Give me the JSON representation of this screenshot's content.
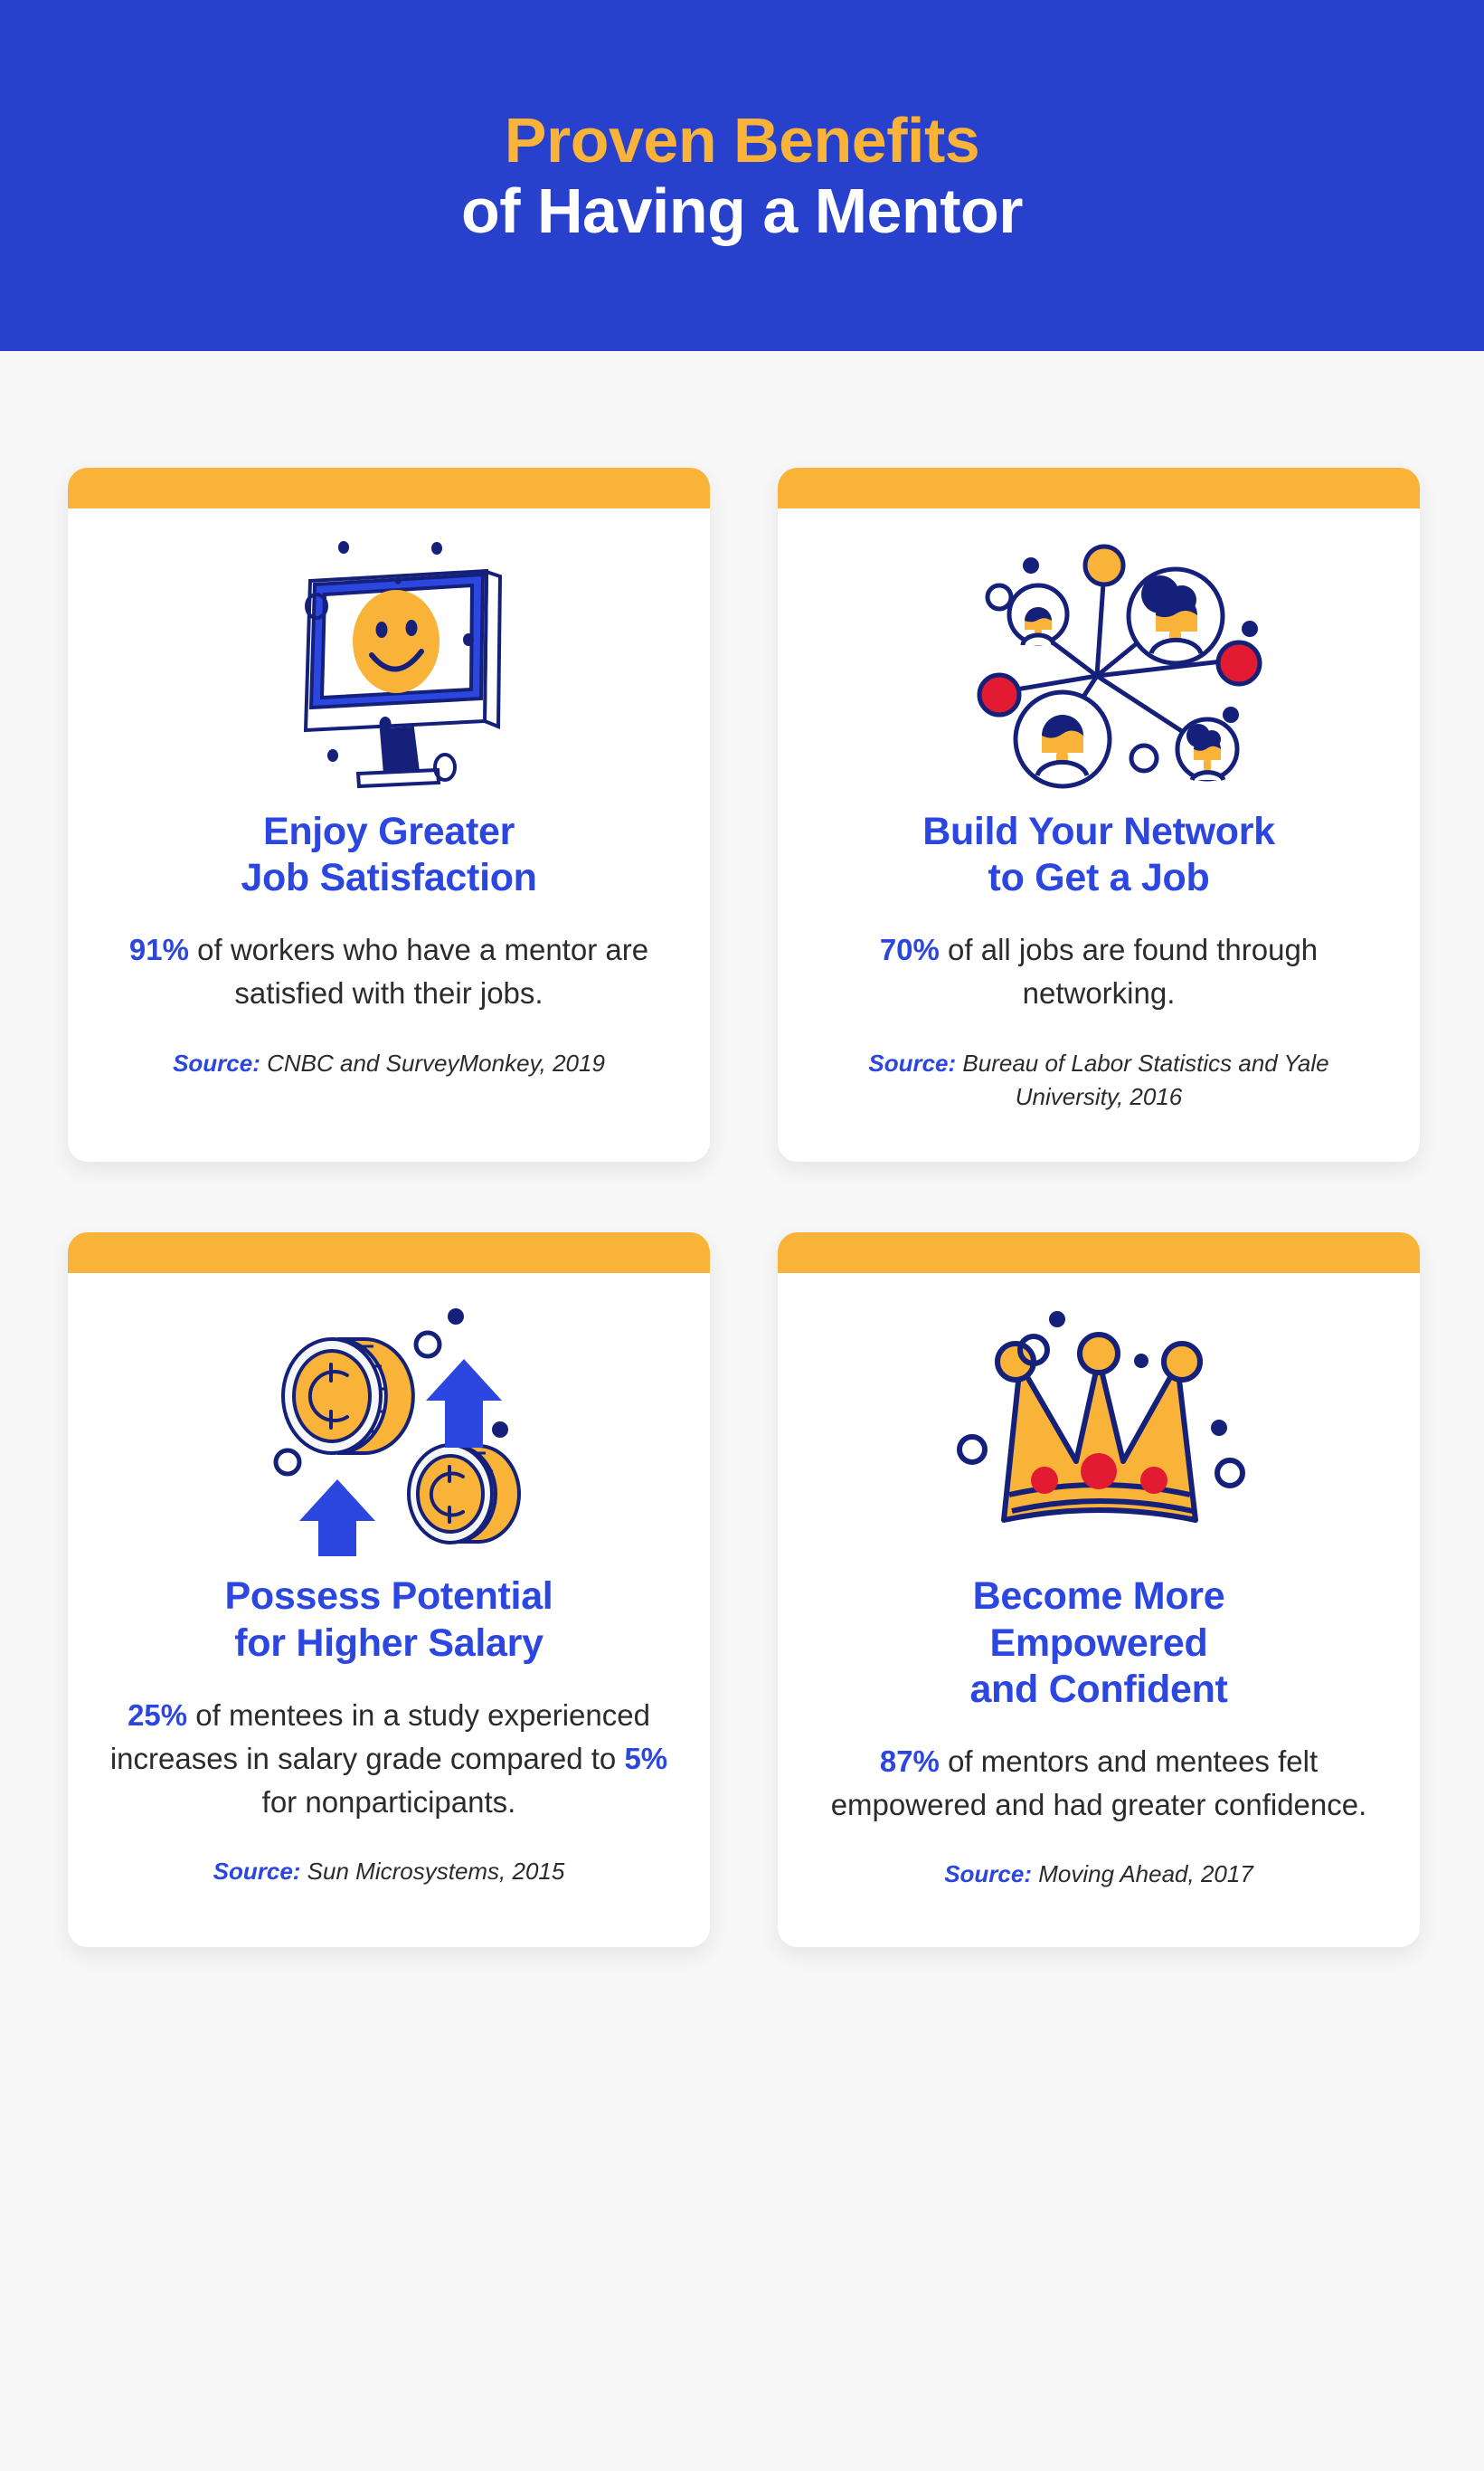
{
  "header": {
    "title_line1": "Proven Benefits",
    "title_line2": "of Having a Mentor",
    "bg_color": "#2741CC",
    "accent_color": "#F9B338"
  },
  "theme": {
    "page_bg": "#F7F7F8",
    "card_bg": "#FFFFFF",
    "card_topbar": "#F9B338",
    "title_blue": "#2C46E0",
    "line_navy": "#14207A",
    "yellow": "#F9B338",
    "red": "#E31B32",
    "body_text": "#2B2B2B"
  },
  "cards": [
    {
      "icon": "smiley-monitor-icon",
      "title_line1": "Enjoy Greater",
      "title_line2": "Job Satisfaction",
      "stat_value": "91%",
      "stat_text": " of workers who have a mentor are satisfied with their jobs.",
      "source_label": "Source:",
      "source_text": " CNBC and SurveyMonkey, 2019"
    },
    {
      "icon": "people-network-icon",
      "title_line1": "Build Your Network",
      "title_line2": "to Get a Job",
      "stat_value": "70%",
      "stat_text": " of all jobs are found through networking.",
      "source_label": "Source:",
      "source_text": " Bureau of Labor Statistics and Yale University, 2016"
    },
    {
      "icon": "coins-up-arrows-icon",
      "title_line1": "Possess Potential",
      "title_line2": "for Higher Salary",
      "stat_value": "25%",
      "stat_text_a": " of mentees in a study experienced increases in salary grade compared to ",
      "stat_value_2": "5%",
      "stat_text_b": " for nonparticipants.",
      "source_label": "Source:",
      "source_text": " Sun Microsystems, 2015"
    },
    {
      "icon": "crown-icon",
      "title_line1": "Become More",
      "title_line2": "Empowered",
      "title_line3": "and Confident",
      "stat_value": "87%",
      "stat_text": " of mentors and mentees felt empowered and had greater confidence.",
      "source_label": "Source:",
      "source_text": " Moving Ahead, 2017"
    }
  ]
}
